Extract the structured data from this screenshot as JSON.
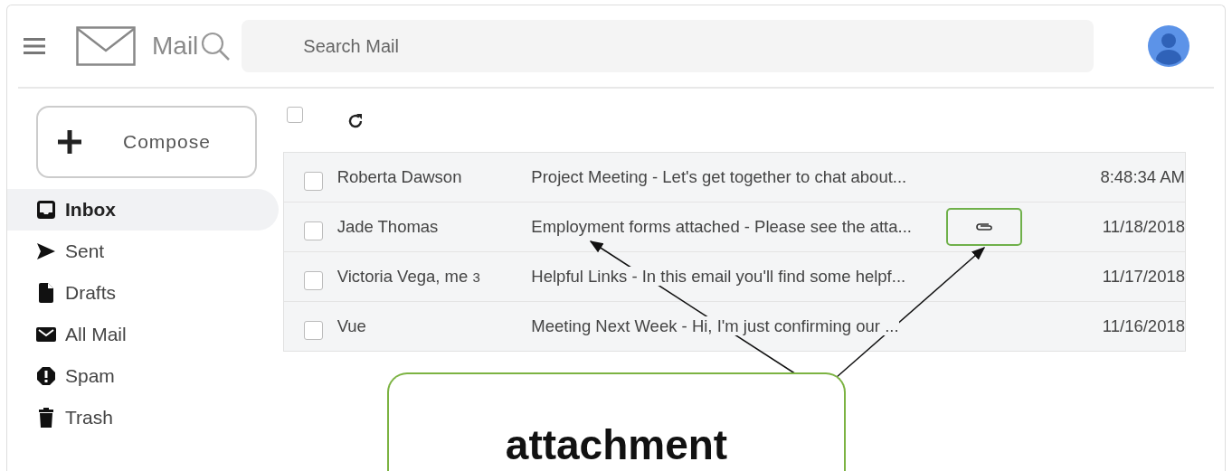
{
  "header": {
    "app_name": "Mail",
    "search": {
      "placeholder": "Search Mail"
    }
  },
  "sidebar": {
    "compose": "Compose",
    "items": [
      {
        "label": "Inbox",
        "kind": "inbox",
        "selected": true
      },
      {
        "label": "Sent",
        "kind": "send",
        "selected": false
      },
      {
        "label": "Drafts",
        "kind": "draft",
        "selected": false
      },
      {
        "label": "All Mail",
        "kind": "mail",
        "selected": false
      },
      {
        "label": "Spam",
        "kind": "spam",
        "selected": false
      },
      {
        "label": "Trash",
        "kind": "trash",
        "selected": false
      }
    ]
  },
  "toolbar": {
    "select_all_checked": false
  },
  "emails": [
    {
      "sender": "Roberta Dawson",
      "subject": "Project Meeting - Let's get together to chat about...",
      "attachment": false,
      "time": "8:48:34 AM",
      "checked": false
    },
    {
      "sender": "Jade Thomas",
      "subject": "Employment forms attached - Please see the atta...",
      "attachment": true,
      "time": "11/18/2018",
      "checked": false
    },
    {
      "sender": "Victoria Vega, me",
      "count": "3",
      "subject": "Helpful Links - In this email you'll find some helpf...",
      "attachment": false,
      "time": "11/17/2018",
      "checked": false
    },
    {
      "sender": "Vue",
      "subject": "Meeting Next Week - Hi, I'm just confirming our ...",
      "attachment": false,
      "time": "11/16/2018",
      "checked": false
    }
  ],
  "annotation": {
    "label": "attachment"
  }
}
